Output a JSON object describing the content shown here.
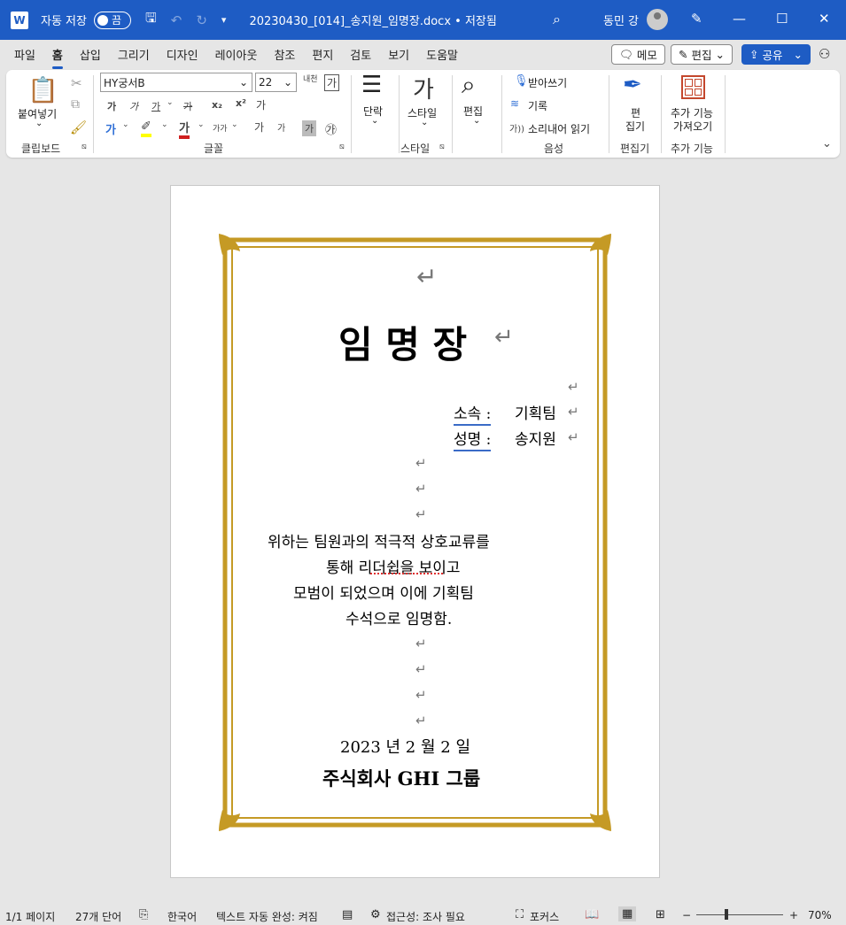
{
  "titlebar": {
    "app_icon": "word-icon",
    "autosave_label": "자동 저장",
    "autosave_state": "끔",
    "doc_title": "20230430_[014]_송지원_임명장.docx • 저장됨",
    "user_name": "동민 강"
  },
  "menu": {
    "tabs": [
      "파일",
      "홈",
      "삽입",
      "그리기",
      "디자인",
      "레이아웃",
      "참조",
      "편지",
      "검토",
      "보기",
      "도움말"
    ],
    "active_tab": "홈",
    "memo_label": "메모",
    "edit_label": "편집",
    "share_label": "공유"
  },
  "ribbon": {
    "paste_label": "붙여넣기",
    "clipboard_label": "클립보드",
    "font_name": "HY궁서B",
    "font_size": "22",
    "font_group_label": "글꼴",
    "paragraph_label": "단락",
    "style_label": "스타일",
    "style_group_label": "스타일",
    "editing_label": "편집",
    "dictate_label": "받아쓰기",
    "record_label": "기록",
    "read_aloud_label": "소리내어 읽기",
    "voice_group_label": "음성",
    "editor_label_1": "편",
    "editor_label_2": "집기",
    "editor_group_label": "편집기",
    "addins_label_1": "추가 기능",
    "addins_label_2": "가져오기",
    "addins_group_label": "추가 기능",
    "bold": "가",
    "italic": "가",
    "underline": "가",
    "strike": "가",
    "subscript": "x₂",
    "superscript": "x²",
    "clear_format": "가",
    "font_color": "가",
    "char_shading": "가",
    "enclosed": "㉮",
    "grow_font": "가",
    "shrink_font": "가",
    "case": "가가",
    "text_effect": "가",
    "phonetic": "내천",
    "char_border": "가"
  },
  "document": {
    "title": "임 명 장",
    "dept_label": "소속 :",
    "dept_value": "기획팀",
    "name_label": "성명 :",
    "name_value": "송지원",
    "body_line_1": "위하는 팀원과의 적극적 상호교류를",
    "body_line_2": "통해 리더쉽을 보이고",
    "body_line_3": "모범이 되었으며 이에 기획팀",
    "body_line_4": "수석으로 임명함.",
    "date": "2023 년 2 월 2 일",
    "company": "주식회사 GHI 그룹",
    "frame_color": "#c59a25",
    "para_mark": "↵"
  },
  "status": {
    "page": "1/1 페이지",
    "words": "27개 단어",
    "language": "한국어",
    "autocomplete": "텍스트 자동 완성: 켜짐",
    "accessibility": "접근성: 조사 필요",
    "focus": "포커스",
    "zoom": "70%"
  }
}
